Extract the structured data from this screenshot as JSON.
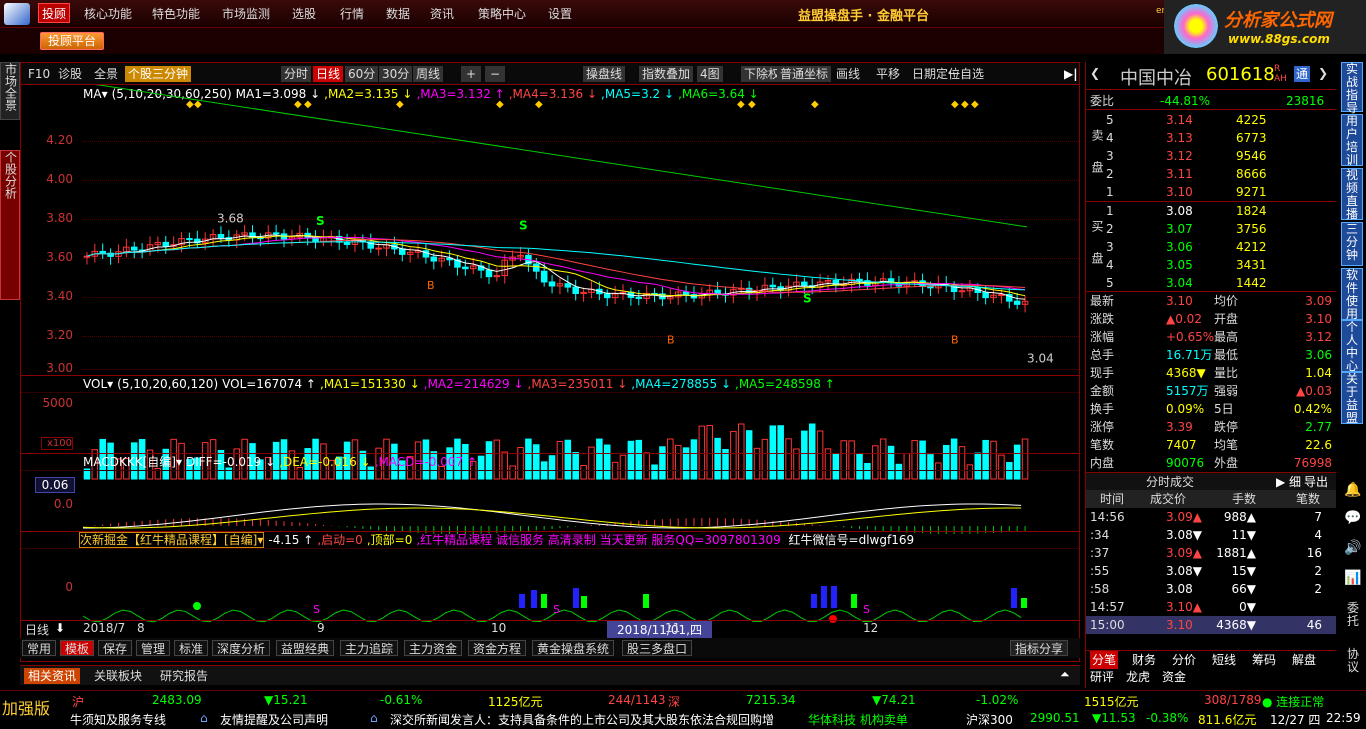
{
  "menu": {
    "items": [
      "投顾",
      "核心功能",
      "特色功能",
      "市场监测",
      "选股",
      "行情",
      "数据",
      "资讯",
      "策略中心",
      "设置"
    ],
    "app_title": "益盟操盘手 · 金融平台",
    "er_label": "er"
  },
  "brand": {
    "name": "分析家公式网",
    "url": "www.88gs.com"
  },
  "toolbar2": {
    "advisor_platform": "投顾平台"
  },
  "left_tabs": [
    "市场全景",
    "个股分析"
  ],
  "chart_toolbar": {
    "left": [
      "F10",
      "诊股",
      "全景"
    ],
    "min3": "个股三分钟",
    "periods": [
      "分时",
      "日线",
      "60分",
      "30分",
      "周线"
    ],
    "plus": "+",
    "minus": "−",
    "right": [
      "操盘线",
      "指数叠加",
      "4图",
      "下除权",
      "普通坐标",
      "画线",
      "平移",
      "日期定位",
      "一自选"
    ]
  },
  "ma_legend": {
    "name": "MA▾",
    "params": "(5,10,20,30,60,250)",
    "items": [
      {
        "t": "MA1=3.098 ↓",
        "c": "#fff"
      },
      {
        "t": ",MA2=3.135 ↓",
        "c": "#ff0"
      },
      {
        "t": ",MA3=3.132 ↑",
        "c": "#f0f"
      },
      {
        "t": ",MA4=3.136 ↓",
        "c": "#f44"
      },
      {
        "t": ",MA5=3.2 ↓",
        "c": "#0ff"
      },
      {
        "t": ",MA6=3.64 ↓",
        "c": "#0f0"
      }
    ]
  },
  "price_axis": [
    "4.20",
    "4.00",
    "3.80",
    "3.60",
    "3.40",
    "3.20",
    "3.00"
  ],
  "price_annot": {
    "high": "3.68",
    "low": "3.04"
  },
  "vol_legend": {
    "name": "VOL▾",
    "params": "(5,10,20,60,120)",
    "items": [
      {
        "t": "VOL=167074 ↑",
        "c": "#fff"
      },
      {
        "t": ",MA1=151330 ↓",
        "c": "#ff0"
      },
      {
        "t": ",MA2=214629 ↓",
        "c": "#f0f"
      },
      {
        "t": ",MA3=235011 ↓",
        "c": "#f44"
      },
      {
        "t": ",MA4=278855 ↓",
        "c": "#0ff"
      },
      {
        "t": ",MA5=248598 ↑",
        "c": "#0f0"
      }
    ]
  },
  "vol_axis": {
    "v": "5000",
    "unit": "x100"
  },
  "macd_legend": {
    "name": "MACDKKK[自编]▾",
    "items": [
      {
        "t": "DIFF=-0.019 ↓",
        "c": "#fff"
      },
      {
        "t": ",DEA=-0.016 ↓",
        "c": "#ff0"
      },
      {
        "t": ",MACD=-0.007 ↑",
        "c": "#f0f"
      }
    ]
  },
  "macd_axis": {
    "top": "0.06",
    "zero": "0.0"
  },
  "custom_legend": {
    "name": "次新掘金【红牛精品课程】[自编]▾",
    "items": [
      {
        "t": "-4.15 ↑",
        "c": "#fff"
      },
      {
        "t": ",启动=0",
        "c": "#f44"
      },
      {
        "t": ",顶部=0",
        "c": "#ff0"
      },
      {
        "t": ",红牛精品课程 诚信服务 高清录制 当天更新 服务QQ=3097801309",
        "c": "#f0f"
      },
      {
        "t": " 红牛微信号=dlwgf169",
        "c": "#fff"
      }
    ]
  },
  "custom_axis": {
    "zero": "0"
  },
  "date_axis": {
    "period": "日线",
    "labels": [
      "2018/7",
      "8",
      "9",
      "10",
      "11",
      "12"
    ],
    "cursor": "2018/11/01,四"
  },
  "bottom_tabs": [
    "常用",
    "模板",
    "保存",
    "管理",
    "标准",
    "深度分析",
    "益盟经典",
    "主力追踪",
    "主力资金",
    "资金方程",
    "黄金操盘系统",
    "股三多盘口"
  ],
  "share": "指标分享",
  "info_tabs": [
    "相关资讯",
    "关联板块",
    "研究报告"
  ],
  "stock": {
    "name": "中国中冶",
    "code": "601618",
    "flags": "R AH"
  },
  "order": {
    "wb_label": "委比",
    "wb": "-44.81%",
    "wc": "23816",
    "sell_label": "卖盘",
    "buy_label": "买盘",
    "sells": [
      {
        "l": "5",
        "p": "3.14",
        "v": "4225"
      },
      {
        "l": "4",
        "p": "3.13",
        "v": "6773"
      },
      {
        "l": "3",
        "p": "3.12",
        "v": "9546"
      },
      {
        "l": "2",
        "p": "3.11",
        "v": "8666"
      },
      {
        "l": "1",
        "p": "3.10",
        "v": "9271"
      }
    ],
    "buys": [
      {
        "l": "1",
        "p": "3.08",
        "v": "1824"
      },
      {
        "l": "2",
        "p": "3.07",
        "v": "3756"
      },
      {
        "l": "3",
        "p": "3.06",
        "v": "4212"
      },
      {
        "l": "4",
        "p": "3.05",
        "v": "3431"
      },
      {
        "l": "5",
        "p": "3.04",
        "v": "1442"
      }
    ]
  },
  "quote": [
    {
      "a": "最新",
      "av": "3.10",
      "ac": "#f44",
      "b": "均价",
      "bv": "3.09",
      "bc": "#f44"
    },
    {
      "a": "涨跌",
      "av": "▲0.02",
      "ac": "#f44",
      "b": "开盘",
      "bv": "3.10",
      "bc": "#f44"
    },
    {
      "a": "涨幅",
      "av": "+0.65%",
      "ac": "#f44",
      "b": "最高",
      "bv": "3.12",
      "bc": "#f44"
    },
    {
      "a": "总手",
      "av": "16.71万",
      "ac": "#0ff",
      "b": "最低",
      "bv": "3.06",
      "bc": "#0f0"
    },
    {
      "a": "现手",
      "av": "4368▼",
      "ac": "#ff0",
      "b": "量比",
      "bv": "1.04",
      "bc": "#ff0"
    },
    {
      "a": "金额",
      "av": "5157万",
      "ac": "#0ff",
      "b": "强弱",
      "bv": "▲0.03",
      "bc": "#f44"
    },
    {
      "a": "换手",
      "av": "0.09%",
      "ac": "#ff0",
      "b": "5日",
      "bv": "0.42%",
      "bc": "#ff0"
    },
    {
      "a": "涨停",
      "av": "3.39",
      "ac": "#f44",
      "b": "跌停",
      "bv": "2.77",
      "bc": "#0f0"
    },
    {
      "a": "笔数",
      "av": "7407",
      "ac": "#ff0",
      "b": "均笔",
      "bv": "22.6",
      "bc": "#ff0"
    },
    {
      "a": "内盘",
      "av": "90076",
      "ac": "#0f0",
      "b": "外盘",
      "bv": "76998",
      "bc": "#f44"
    }
  ],
  "ticks": {
    "title": "分时成交",
    "tabs": [
      "细",
      "导出"
    ],
    "headers": [
      "时间",
      "成交价",
      "手数",
      "笔数"
    ],
    "rows": [
      {
        "t": "14:56",
        "p": "3.09▲",
        "pc": "#f44",
        "v": "988▲",
        "vc": "#fff",
        "n": "7"
      },
      {
        "t": ":34",
        "p": "3.08▼",
        "pc": "#fff",
        "v": "11▼",
        "vc": "#fff",
        "n": "4"
      },
      {
        "t": ":37",
        "p": "3.09▲",
        "pc": "#f44",
        "v": "1881▲",
        "vc": "#fff",
        "n": "16"
      },
      {
        "t": ":55",
        "p": "3.08▼",
        "pc": "#fff",
        "v": "15▼",
        "vc": "#fff",
        "n": "2"
      },
      {
        "t": ":58",
        "p": "3.08",
        "pc": "#fff",
        "v": "66▼",
        "vc": "#fff",
        "n": "2"
      },
      {
        "t": "14:57",
        "p": "3.10▲",
        "pc": "#f44",
        "v": "0▼",
        "vc": "#fff",
        "n": ""
      },
      {
        "t": "15:00",
        "p": "3.10",
        "pc": "#f44",
        "v": "4368▼",
        "vc": "#fff",
        "n": "46"
      }
    ]
  },
  "rp_tabs1": [
    "分笔",
    "财务",
    "分价",
    "短线",
    "筹码",
    "解盘"
  ],
  "rp_tabs2": [
    "研评",
    "龙虎",
    "资金"
  ],
  "right_tabs": [
    "实战指导",
    "用户培训",
    "视频直播",
    "三分钟",
    "软件使用",
    "个人中心",
    "关于益盟",
    "委托",
    "协议"
  ],
  "status": {
    "boost": "加强版",
    "sh": "沪",
    "sh_idx": "2483.09",
    "sh_chg": "▼15.21",
    "sh_pct": "-0.61%",
    "sh_amt": "1125亿元",
    "sh_ud": "244/1143",
    "sz": "深",
    "sz_idx": "7215.34",
    "sz_chg": "▼74.21",
    "sz_pct": "-1.02%",
    "sz_amt": "1515亿元",
    "sz_ud": "308/1789",
    "conn": "连接正常",
    "ticker1": "牛须知及服务专线",
    "ticker2": "友情提醒及公司声明",
    "ticker3": "深交所新闻发言人：支持具备条件的上市公司及其大股东依法合规回购增",
    "hot": "华体科技 机构卖单",
    "hs": "沪深300",
    "hs_idx": "2990.51",
    "hs_chg": "▼11.53",
    "hs_pct": "-0.38%",
    "hs_amt": "811.6亿元",
    "date": "12/27 四",
    "time": "22:59"
  }
}
